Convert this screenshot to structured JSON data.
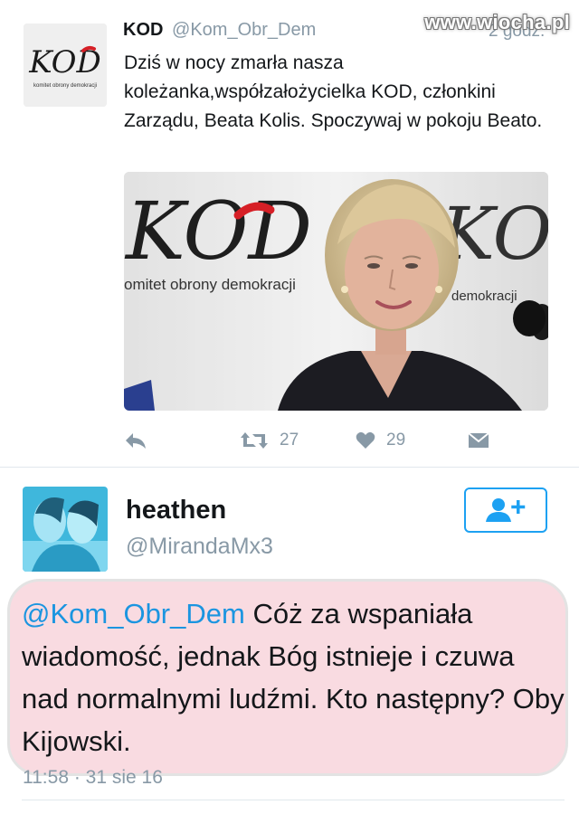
{
  "watermark": "www.wiocha.pl",
  "tweet": {
    "author_name": "KOD",
    "author_handle": "@Kom_Obr_Dem",
    "time": "2 godz.",
    "avatar_text": "KOD",
    "avatar_subtext": "komitet obrony demokracji",
    "text": "Dziś w nocy zmarła nasza koleżanka,współzałożycielka KOD, członkini Zarządu, Beata Kolis. Spoczywaj w pokoju Beato.",
    "media": {
      "logo_text": "KOD",
      "logo_subtext": "omitet obrony demokracji",
      "logo_text_2": "KOD",
      "logo_subtext_2": "demokracji"
    },
    "retweets": "27",
    "likes": "29"
  },
  "reply": {
    "name": "heathen",
    "handle": "@MirandaMx3",
    "mention": "@Kom_Obr_Dem",
    "text": " Cóż za wspaniała wiadomość, jednak Bóg istnieje i czuwa nad normalnymi ludźmi. Kto następny? Oby Kijowski.",
    "timestamp": "11:58 · 31 sie 16"
  },
  "colors": {
    "accent": "#1da1f2",
    "mention": "#1b95e0",
    "muted": "#8899a6",
    "highlight": "#f4bec8",
    "logo_red": "#d61f26"
  }
}
